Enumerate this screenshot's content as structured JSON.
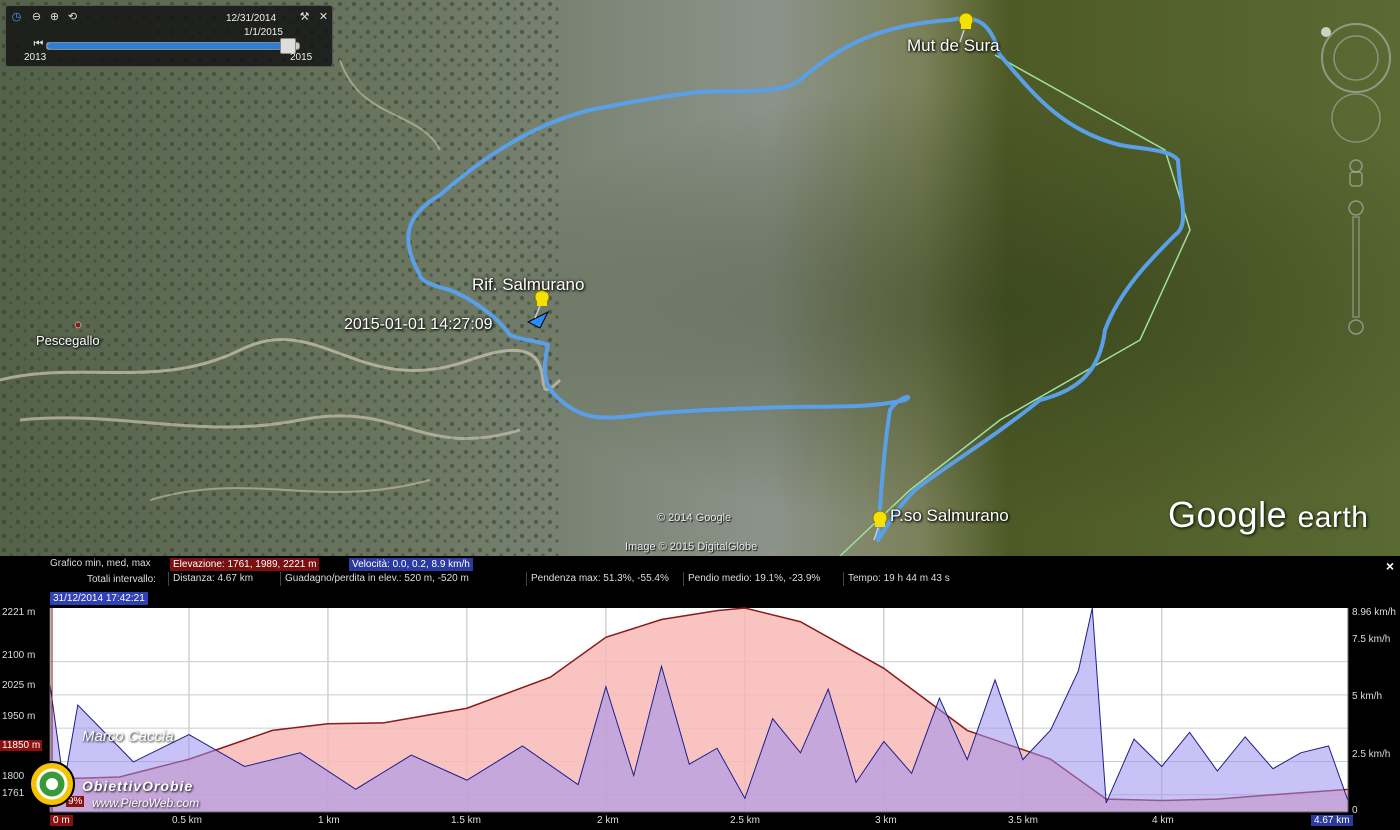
{
  "map": {
    "labels": {
      "mut": "Mut de Sura",
      "rif": "Rif. Salmurano",
      "timestamp": "2015-01-01 14:27:09",
      "pescegallo": "Pescegallo",
      "passo": "P.so Salmurano",
      "copyright1": "© 2014 Google",
      "copyright2": "Image © 2015 DigitalGlobe",
      "brand_google": "Google",
      "brand_earth": "earth"
    },
    "timeslider": {
      "end_date": "12/31/2014",
      "current_date": "1/1/2015",
      "start_year": "2013",
      "end_year": "2015",
      "position": 0.95
    },
    "colors": {
      "track": "#5aa0e8",
      "path": "#9fe0a0",
      "pin": "#f5e000"
    }
  },
  "profile": {
    "graph_label": "Grafico  min, med, max",
    "elevation": "Elevazione: 1761, 1989, 2221 m",
    "speed": "Velocità: 0.0, 0.2, 8.9 km/h",
    "totals_label": "Totali intervallo:",
    "distance": "Distanza: 4.67 km",
    "gain": "Guadagno/perdita in elev.: 520 m, -520 m",
    "slope_max": "Pendenza max: 51.3%, -55.4%",
    "slope_avg": "Pendio medio: 19.1%, -23.9%",
    "time": "Tempo: 19 h 44 m 43 s",
    "cursor_time": "31/12/2014 17:42:21",
    "close": "×",
    "y_left": [
      "2221 m",
      "2100 m",
      "2025 m",
      "1950 m",
      "11850 m",
      "1800",
      "1761"
    ],
    "y_right": [
      "8.96 km/h",
      "7.5 km/h",
      "5 km/h",
      "2.5 km/h",
      "0"
    ],
    "x_ticks": [
      "0 m",
      "0.5 km",
      "1 km",
      "1.5 km",
      "2 km",
      "2.5 km",
      "3 km",
      "3.5 km",
      "4 km",
      "4.67 km"
    ],
    "badge_pct": "9%"
  },
  "chart_data": {
    "type": "area",
    "xlabel": "",
    "ylabel": "",
    "xlim": [
      0,
      4.67
    ],
    "ylim_left": [
      1761,
      2221
    ],
    "ylim_right": [
      0,
      8.96
    ],
    "series": [
      {
        "name": "Elevazione",
        "axis": "left",
        "x": [
          0,
          0.25,
          0.5,
          0.8,
          1.0,
          1.2,
          1.5,
          1.8,
          2.0,
          2.2,
          2.4,
          2.5,
          2.7,
          3.0,
          3.3,
          3.6,
          3.8,
          4.0,
          4.2,
          4.4,
          4.67
        ],
        "values": [
          1835,
          1840,
          1880,
          1945,
          1960,
          1962,
          1995,
          2065,
          2155,
          2195,
          2215,
          2221,
          2190,
          2085,
          1945,
          1880,
          1790,
          1787,
          1790,
          1800,
          1812
        ]
      },
      {
        "name": "Velocità",
        "axis": "right",
        "x": [
          0,
          0.05,
          0.1,
          0.3,
          0.5,
          0.7,
          0.9,
          1.1,
          1.3,
          1.5,
          1.7,
          1.9,
          2.0,
          2.1,
          2.2,
          2.3,
          2.4,
          2.5,
          2.6,
          2.7,
          2.8,
          2.9,
          3.0,
          3.1,
          3.2,
          3.3,
          3.4,
          3.5,
          3.6,
          3.7,
          3.75,
          3.8,
          3.9,
          4.0,
          4.1,
          4.2,
          4.3,
          4.4,
          4.5,
          4.6,
          4.67
        ],
        "values": [
          5.6,
          1.2,
          4.7,
          2.2,
          3.4,
          2.0,
          2.6,
          1.0,
          2.5,
          1.4,
          2.9,
          1.2,
          5.5,
          1.6,
          6.4,
          2.1,
          2.8,
          0.6,
          4.1,
          2.6,
          5.4,
          1.3,
          3.1,
          1.7,
          5.0,
          2.3,
          5.8,
          2.3,
          3.6,
          6.2,
          8.96,
          0.4,
          3.2,
          2.0,
          3.5,
          1.8,
          3.3,
          1.9,
          2.6,
          2.9,
          0.5
        ]
      }
    ]
  }
}
